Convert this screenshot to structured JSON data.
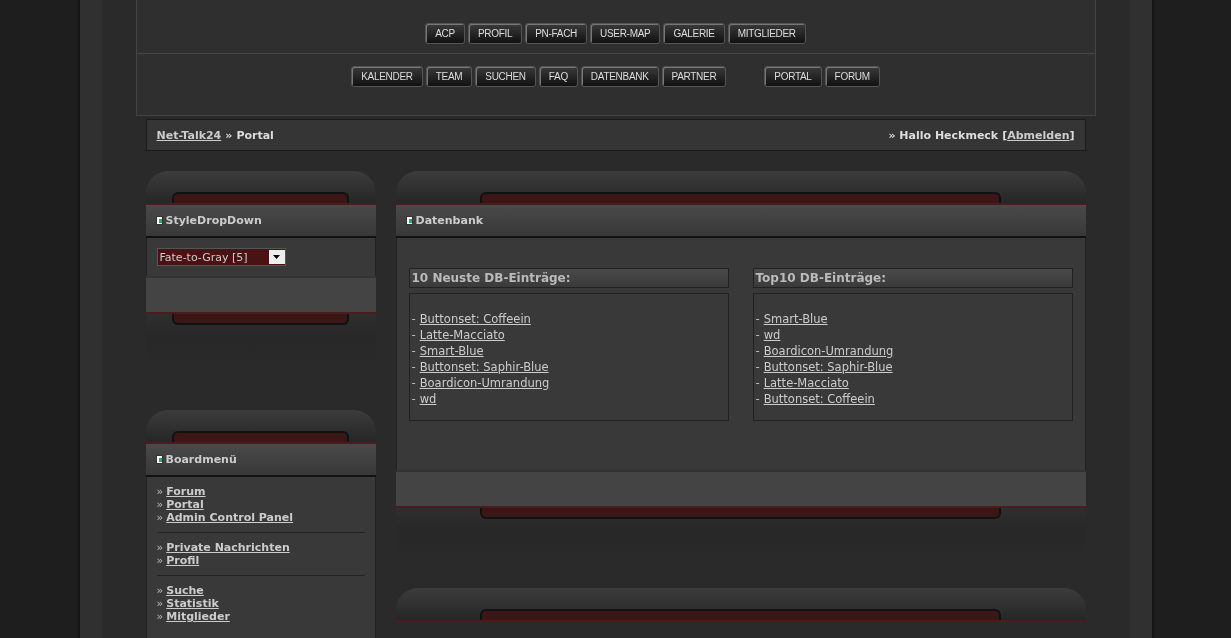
{
  "nav_rows": [
    {
      "groups": [
        [
          "ACP",
          "PROFIL",
          "PN-FACH",
          "USER-MAP",
          "GALERIE",
          "MITGLIEDER"
        ]
      ]
    },
    {
      "groups": [
        [
          "KALENDER",
          "TEAM",
          "SUCHEN",
          "FAQ",
          "DATENBANK",
          "PARTNER"
        ],
        [
          "PORTAL",
          "FORUM"
        ]
      ]
    }
  ],
  "breadcrumb": {
    "home": "Net-Talk24",
    "separator": "»",
    "current": "Portal",
    "greeting": "» Hallo Heckmeck",
    "logout_open": "[",
    "logout": "Abmelden",
    "logout_close": "]"
  },
  "style_panel": {
    "title": "StyleDropDown",
    "select_value": "Fate-to-Gray [5]"
  },
  "board_menu": {
    "title": "Boardmenü",
    "groups": [
      [
        {
          "bullet": "»",
          "label": "Forum"
        },
        {
          "bullet": "»",
          "label": "Portal"
        },
        {
          "bullet": "»",
          "label": "Admin Control Panel"
        }
      ],
      [
        {
          "bullet": "»",
          "label": "Private Nachrichten"
        },
        {
          "bullet": "»",
          "label": "Profil"
        }
      ],
      [
        {
          "bullet": "»",
          "label": "Suche"
        },
        {
          "bullet": "»",
          "label": "Statistik"
        },
        {
          "bullet": "»",
          "label": "Mitglieder"
        }
      ]
    ]
  },
  "database_panel": {
    "title": "Datenbank",
    "lists": [
      {
        "title": "10 Neuste DB-Einträge:",
        "items": [
          {
            "dash": "-",
            "label": "Buttonset: Coffeein"
          },
          {
            "dash": "-",
            "label": "Latte-Macciato"
          },
          {
            "dash": "-",
            "label": "Smart-Blue"
          },
          {
            "dash": "-",
            "label": "Buttonset: Saphir-Blue"
          },
          {
            "dash": "-",
            "label": "Boardicon-Umrandung"
          },
          {
            "dash": "-",
            "label": "wd"
          }
        ]
      },
      {
        "title": "Top10 DB-Einträge:",
        "items": [
          {
            "dash": "-",
            "label": "Smart-Blue"
          },
          {
            "dash": "-",
            "label": "wd"
          },
          {
            "dash": "-",
            "label": "Boardicon-Umrandung"
          },
          {
            "dash": "-",
            "label": "Buttonset: Saphir-Blue"
          },
          {
            "dash": "-",
            "label": "Latte-Macciato"
          },
          {
            "dash": "-",
            "label": "Buttonset: Coffeein"
          }
        ]
      }
    ]
  }
}
